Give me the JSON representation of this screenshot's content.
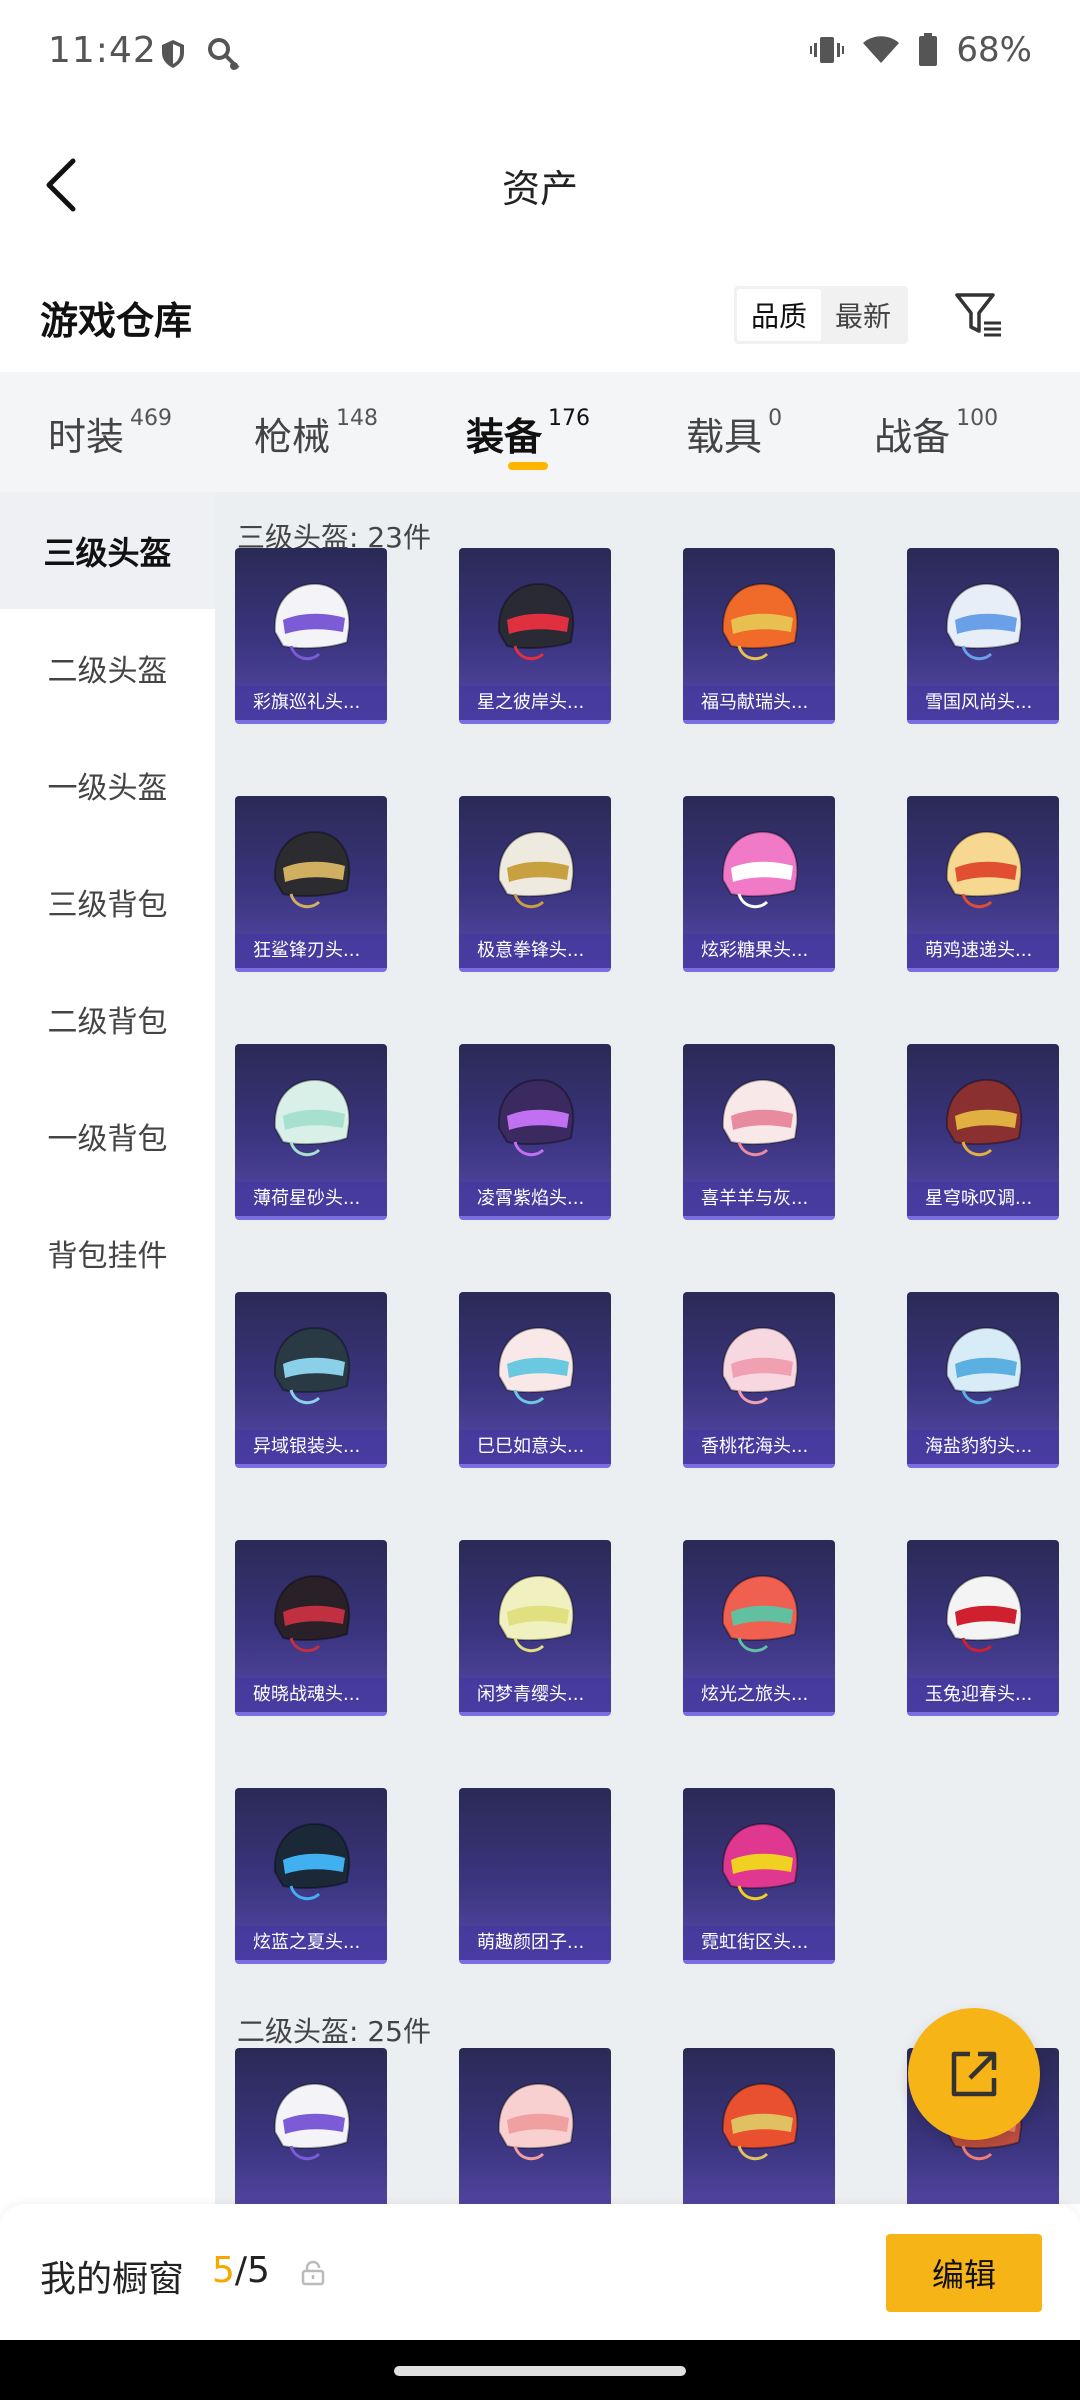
{
  "status_bar": {
    "time": "11:42",
    "battery": "68%",
    "icons": [
      "shield-icon",
      "key-icon",
      "vibrate-icon",
      "wifi-icon",
      "battery-icon"
    ]
  },
  "header": {
    "title": "资产",
    "back_icon": "chevron-left-icon"
  },
  "warehouse": {
    "title": "游戏仓库",
    "sort_options": [
      "品质",
      "最新"
    ],
    "active_sort": "品质",
    "filter_icon": "filter-icon"
  },
  "category_tabs": [
    {
      "label": "时装",
      "count": "469"
    },
    {
      "label": "枪械",
      "count": "148"
    },
    {
      "label": "装备",
      "count": "176",
      "active": true
    },
    {
      "label": "载具",
      "count": "0"
    },
    {
      "label": "战备",
      "count": "100"
    }
  ],
  "sidebar": {
    "items": [
      "三级头盔",
      "二级头盔",
      "一级头盔",
      "三级背包",
      "二级背包",
      "一级背包",
      "背包挂件"
    ],
    "active": "三级头盔"
  },
  "sections": [
    {
      "title": "三级头盔: 23件",
      "items": [
        {
          "name": "彩旗巡礼头...",
          "color": "#f4f4f8",
          "accent": "#7b5cd6"
        },
        {
          "name": "星之彼岸头...",
          "color": "#2a2a35",
          "accent": "#e03040"
        },
        {
          "name": "福马献瑞头...",
          "color": "#f06a2a",
          "accent": "#e8c050"
        },
        {
          "name": "雪国风尚头...",
          "color": "#e8eef8",
          "accent": "#6aa0e8"
        },
        {
          "name": "狂鲨锋刃头...",
          "color": "#2b2b30",
          "accent": "#d0b060"
        },
        {
          "name": "极意拳锋头...",
          "color": "#eeeae0",
          "accent": "#c8a040"
        },
        {
          "name": "炫彩糖果头...",
          "color": "#f07ac8",
          "accent": "#ffffff"
        },
        {
          "name": "萌鸡速递头...",
          "color": "#f6d890",
          "accent": "#e05030"
        },
        {
          "name": "薄荷星砂头...",
          "color": "#d8f0e8",
          "accent": "#a8e0d0"
        },
        {
          "name": "凌霄紫焰头...",
          "color": "#3a2a60",
          "accent": "#c070f0"
        },
        {
          "name": "喜羊羊与灰...",
          "color": "#f8e8e8",
          "accent": "#e88aa0"
        },
        {
          "name": "星穹咏叹调...",
          "color": "#8a3030",
          "accent": "#e0b040"
        },
        {
          "name": "异域银装头...",
          "color": "#2a3a44",
          "accent": "#8ad0e8"
        },
        {
          "name": "巳巳如意头...",
          "color": "#f8e8e8",
          "accent": "#6ac8e0"
        },
        {
          "name": "香桃花海头...",
          "color": "#f8d8e0",
          "accent": "#f0a0b0"
        },
        {
          "name": "海盐豹豹头...",
          "color": "#d8ecf8",
          "accent": "#5ab0e0"
        },
        {
          "name": "破晓战魂头...",
          "color": "#2a2028",
          "accent": "#c03040"
        },
        {
          "name": "闲梦青缨头...",
          "color": "#f0f0c0",
          "accent": "#e0e080"
        },
        {
          "name": "炫光之旅头...",
          "color": "#f06050",
          "accent": "#60c0a0"
        },
        {
          "name": "玉兔迎春头...",
          "color": "#f4f4f4",
          "accent": "#d02030"
        },
        {
          "name": "炫蓝之夏头...",
          "color": "#1a2838",
          "accent": "#40b0f0"
        },
        {
          "name": "萌趣颜团子...",
          "color": "",
          "accent": ""
        },
        {
          "name": "霓虹街区头...",
          "color": "#e03890",
          "accent": "#f0d020"
        }
      ]
    },
    {
      "title": "二级头盔: 25件",
      "items": [
        {
          "name": "",
          "color": "#f4f4f8",
          "accent": "#7b5cd6"
        },
        {
          "name": "",
          "color": "#f8d0d0",
          "accent": "#f0a0a0"
        },
        {
          "name": "",
          "color": "#e85030",
          "accent": "#e0c060"
        },
        {
          "name": "",
          "color": "#c05040",
          "accent": "#f08070"
        }
      ]
    }
  ],
  "fab_icon": "share-external-icon",
  "bottom_bar": {
    "label": "我的橱窗",
    "current": "5",
    "total": "/5",
    "lock_icon": "lock-icon",
    "edit_label": "编辑"
  },
  "colors": {
    "accent": "#f7b416",
    "card_bg": "#3b3580",
    "panel_bg": "#eceff2"
  }
}
